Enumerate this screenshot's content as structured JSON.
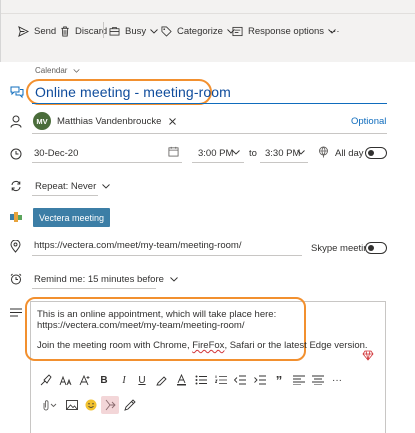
{
  "toolbar": {
    "send": "Send",
    "discard": "Discard",
    "busy": "Busy",
    "categorize": "Categorize",
    "response_options": "Response options",
    "more": "···"
  },
  "calendar_label": "Calendar",
  "event": {
    "title": "Online meeting - meeting-room"
  },
  "attendees": {
    "initials": "MV",
    "name": "Matthias Vandenbroucke",
    "optional_label": "Optional"
  },
  "datetime": {
    "start_date": "30-Dec-20",
    "start_time": "3:00 PM",
    "to_label": "to",
    "end_time": "3:30 PM",
    "all_day_label": "All day",
    "all_day_on": false
  },
  "repeat": {
    "label": "Repeat: Never"
  },
  "vectera": {
    "button_label": "Vectera meeting"
  },
  "location": {
    "value": "https://vectera.com/meet/my-team/meeting-room/",
    "skype_label": "Skype meeting",
    "skype_on": false
  },
  "reminder": {
    "label": "Remind me: 15 minutes before"
  },
  "body": {
    "line1": "This is an online appointment, which will take place here:",
    "line2": "https://vectera.com/meet/my-team/meeting-room/",
    "line3_before": "Join the meeting room with Chrome, ",
    "line3_ff": "FireFox",
    "line3_after": ", Safari or the latest Edge version."
  },
  "format_bar": {
    "bold": "B",
    "italic": "I",
    "underline": "U",
    "quote": "”",
    "more": "···"
  },
  "colors": {
    "accent": "#0f6cbd",
    "title_text": "#0f4c9c",
    "highlight_orange": "#f2902f",
    "vectera_button": "#3c7ea6",
    "avatar": "#4a6c3a"
  }
}
